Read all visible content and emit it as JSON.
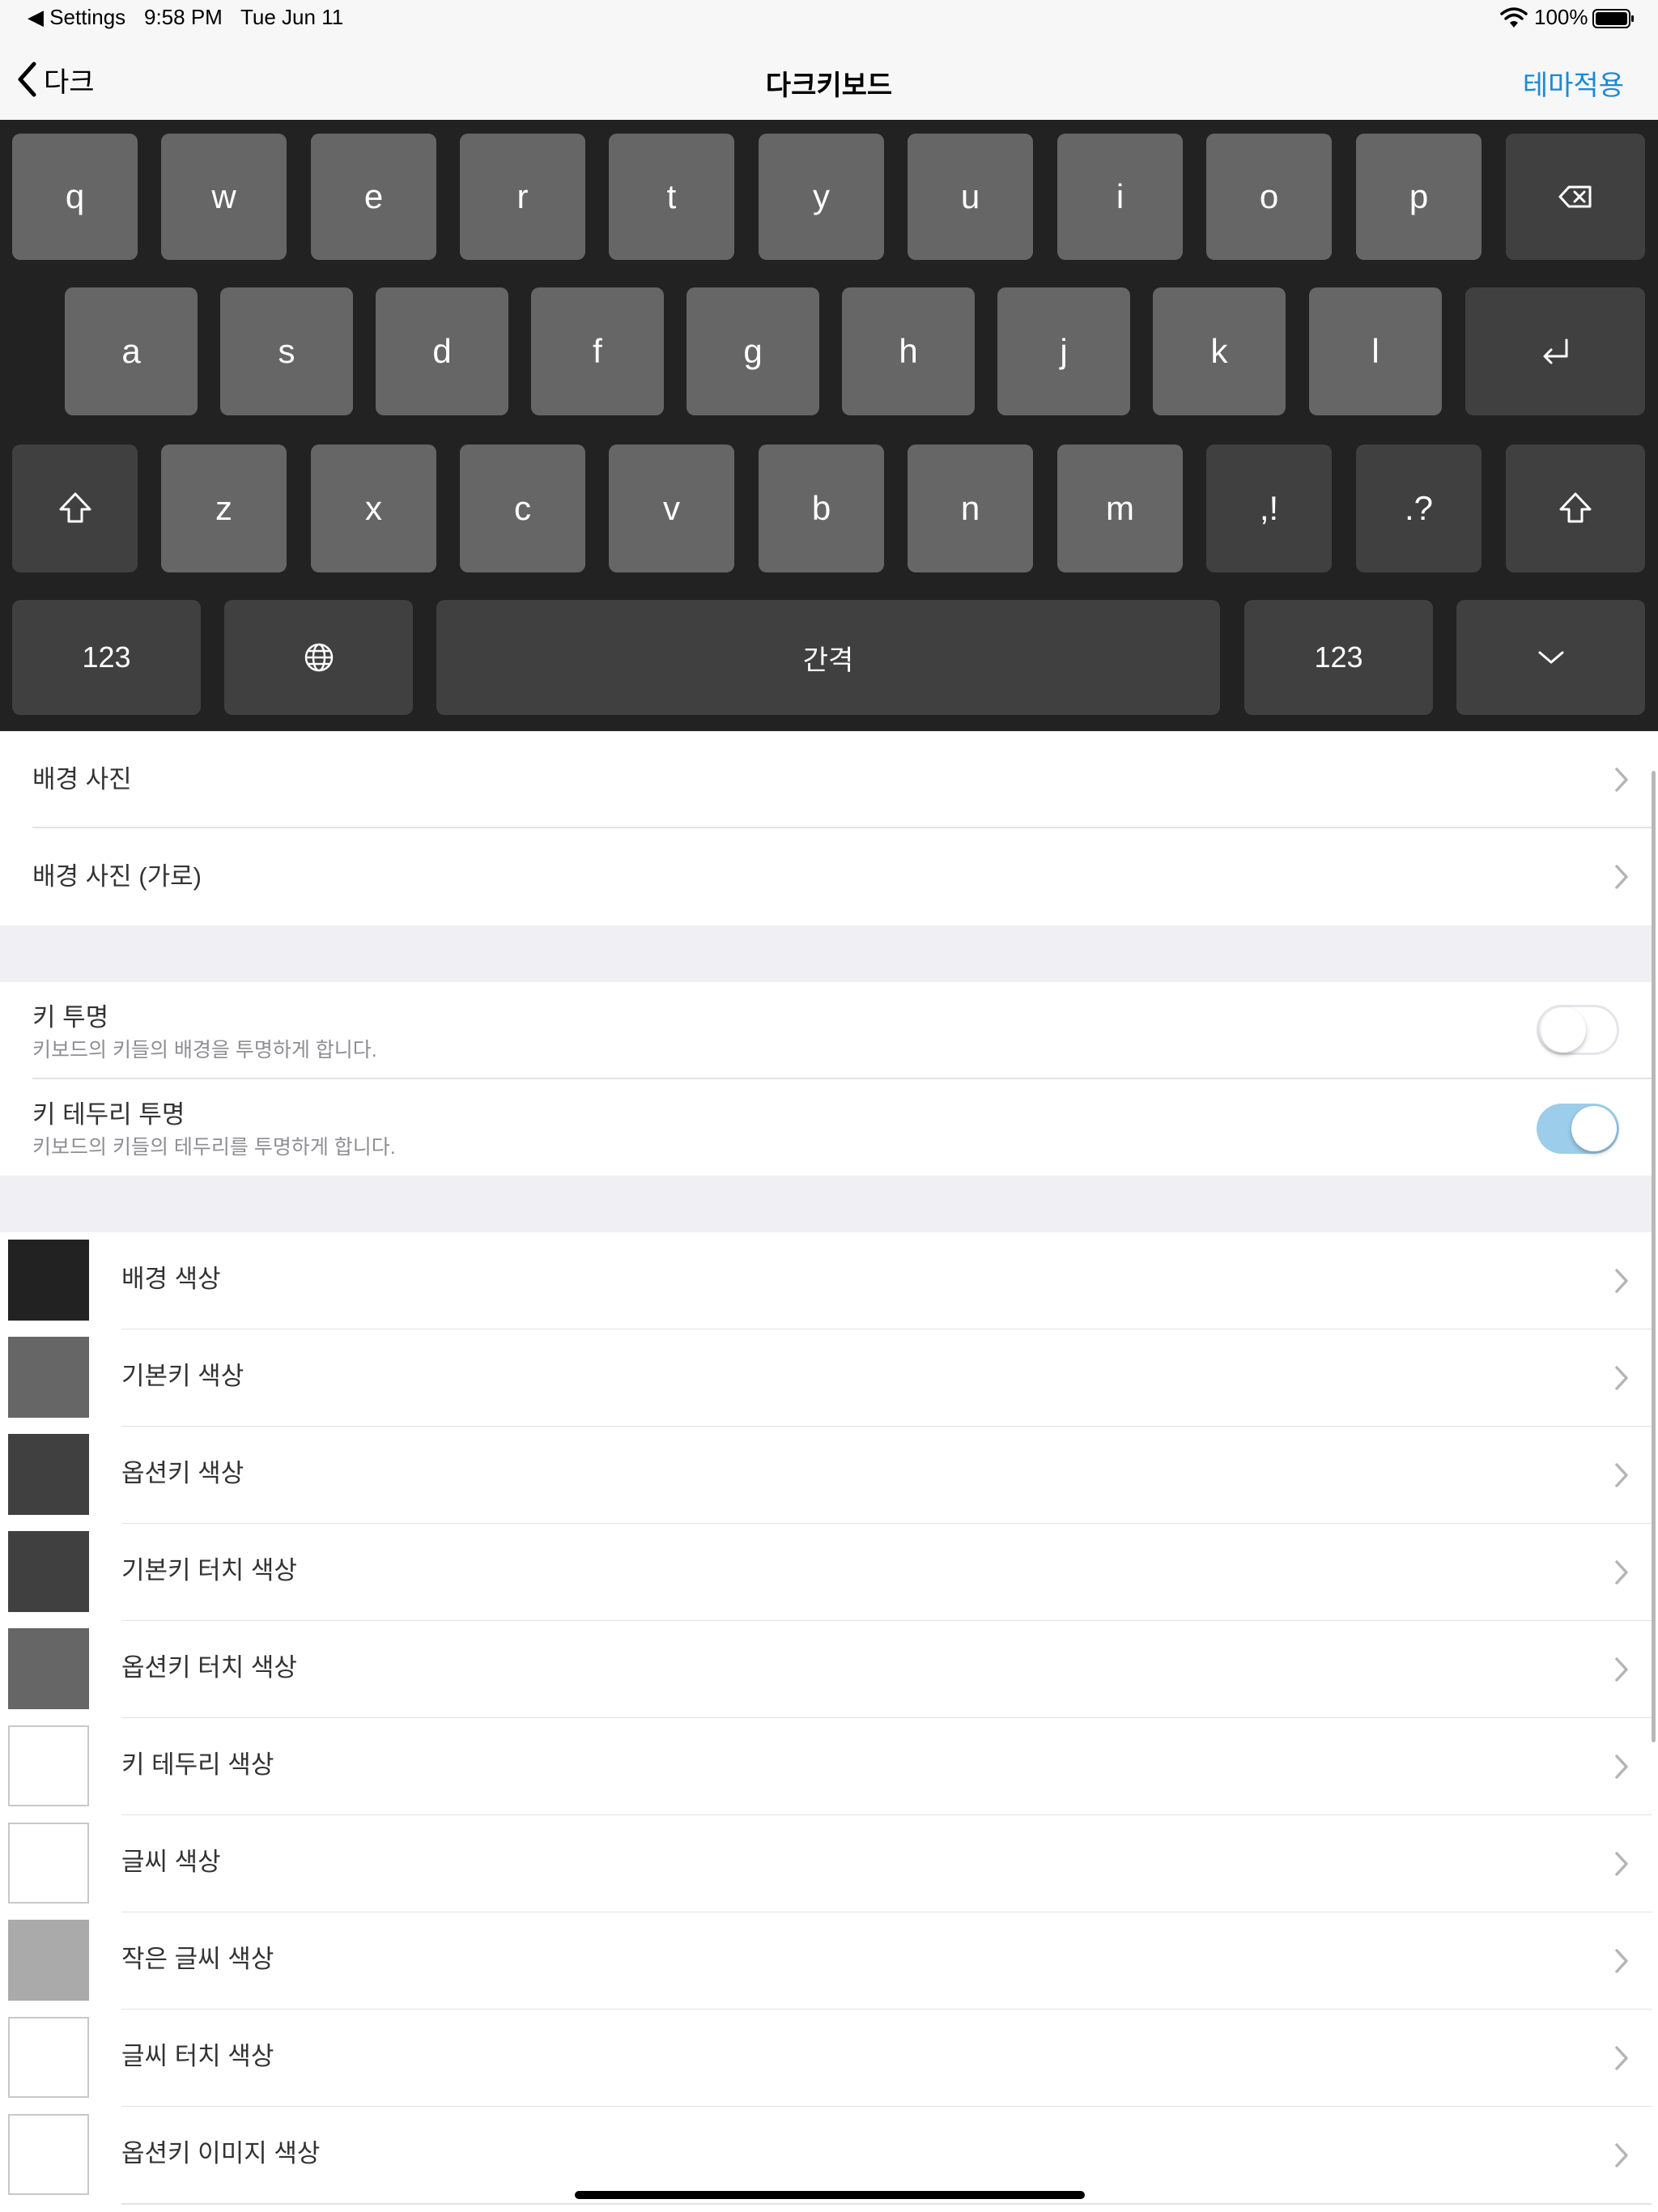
{
  "status_bar": {
    "back_app": "◀ Settings",
    "time": "9:58 PM",
    "date": "Tue Jun 11",
    "battery_pct": "100%"
  },
  "nav": {
    "back_label": "다크",
    "title": "다크키보드",
    "action": "테마적용"
  },
  "keyboard": {
    "row1": [
      "q",
      "w",
      "e",
      "r",
      "t",
      "y",
      "u",
      "i",
      "o",
      "p"
    ],
    "row2": [
      "a",
      "s",
      "d",
      "f",
      "g",
      "h",
      "j",
      "k",
      "l"
    ],
    "row3": [
      "z",
      "x",
      "c",
      "v",
      "b",
      "n",
      "m"
    ],
    "row3_options": [
      ",!",
      ".?"
    ],
    "bottom": {
      "numbers_left": "123",
      "space": "간격",
      "numbers_right": "123"
    },
    "icons": [
      "backspace-icon",
      "return-icon",
      "shift-icon",
      "globe-icon",
      "keyboard-dismiss-icon"
    ]
  },
  "settings": {
    "background_photo": "배경 사진",
    "background_photo_landscape": "배경 사진 (가로)",
    "key_transparent": {
      "label": "키 투명",
      "desc": "키보드의 키들의 배경을 투명하게 합니다.",
      "on": false
    },
    "key_border_transparent": {
      "label": "키 테두리 투명",
      "desc": "키보드의 키들의 테두리를 투명하게 합니다.",
      "on": true
    },
    "colors": [
      {
        "label": "배경 색상",
        "color": "#222222"
      },
      {
        "label": "기본키 색상",
        "color": "#666666"
      },
      {
        "label": "옵션키 색상",
        "color": "#404040"
      },
      {
        "label": "기본키 터치 색상",
        "color": "#404040"
      },
      {
        "label": "옵션키 터치 색상",
        "color": "#666666"
      },
      {
        "label": "키 테두리 색상",
        "color": "#ffffff"
      },
      {
        "label": "글씨 색상",
        "color": "#ffffff"
      },
      {
        "label": "작은 글씨 색상",
        "color": "#aaaaaa"
      },
      {
        "label": "글씨 터치 색상",
        "color": "#ffffff"
      },
      {
        "label": "옵션키 이미지 색상",
        "color": "#ffffff"
      }
    ]
  },
  "theme": {
    "accent": "#1a8ad6",
    "toggle_on": "#9ccdea"
  }
}
